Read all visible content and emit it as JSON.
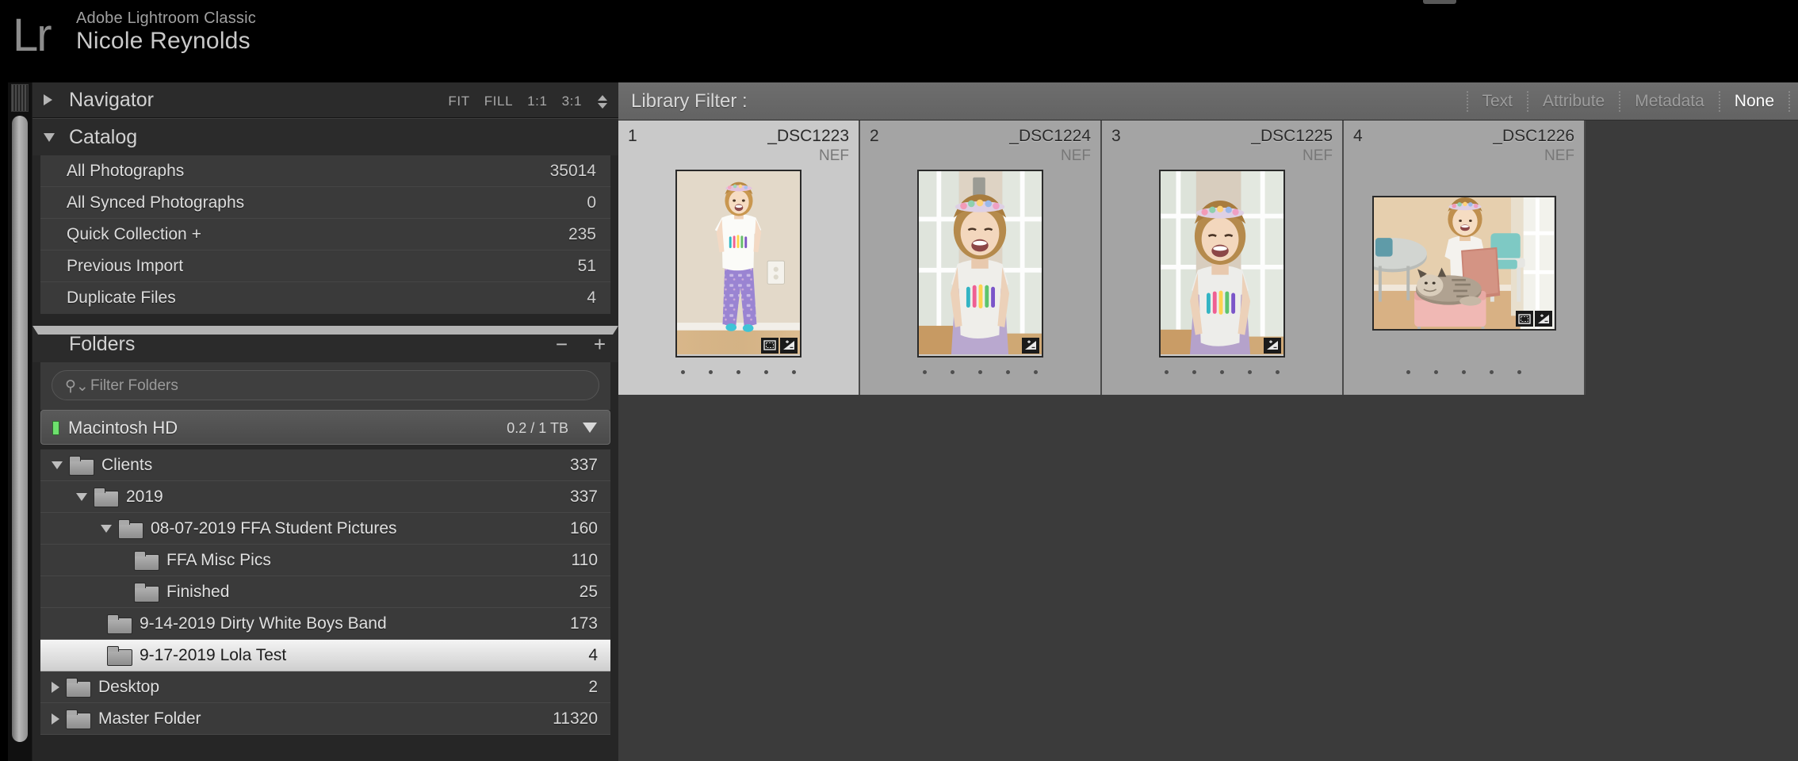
{
  "titlebar": {
    "logo": "Lr",
    "app_name": "Adobe Lightroom Classic",
    "user_name": "Nicole Reynolds"
  },
  "left_panel": {
    "navigator": {
      "title": "Navigator",
      "expanded": false,
      "zoom_levels": [
        "FIT",
        "FILL",
        "1:1",
        "3:1"
      ]
    },
    "catalog": {
      "title": "Catalog",
      "expanded": true,
      "items": [
        {
          "label": "All Photographs",
          "count": "35014"
        },
        {
          "label": "All Synced Photographs",
          "count": "0"
        },
        {
          "label": "Quick Collection",
          "plus": "+",
          "count": "235"
        },
        {
          "label": "Previous Import",
          "count": "51"
        },
        {
          "label": "Duplicate Files",
          "count": "4"
        }
      ]
    },
    "folders": {
      "title": "Folders",
      "expanded": true,
      "minus_label": "−",
      "plus_label": "+",
      "filter_placeholder": "Filter Folders",
      "volume": {
        "name": "Macintosh HD",
        "size": "0.2 / 1 TB",
        "led_color": "#6de06d"
      },
      "tree": [
        {
          "label": "Clients",
          "count": "337",
          "indent": 0,
          "disclosure": "down",
          "selected": false
        },
        {
          "label": "2019",
          "count": "337",
          "indent": 1,
          "disclosure": "down",
          "selected": false
        },
        {
          "label": "08-07-2019 FFA Student Pictures",
          "count": "160",
          "indent": 2,
          "disclosure": "down",
          "selected": false
        },
        {
          "label": "FFA Misc Pics",
          "count": "110",
          "indent": 3,
          "disclosure": "dots",
          "selected": false
        },
        {
          "label": "Finished",
          "count": "25",
          "indent": 3,
          "disclosure": "dots",
          "selected": false
        },
        {
          "label": "9-14-2019 Dirty White Boys Band",
          "count": "173",
          "indent": 2,
          "disclosure": "dots",
          "selected": false
        },
        {
          "label": "9-17-2019 Lola Test",
          "count": "4",
          "indent": 2,
          "disclosure": "dots",
          "selected": true
        },
        {
          "label": "Desktop",
          "count": "2",
          "indent": 0,
          "disclosure": "right",
          "selected": false
        },
        {
          "label": "Master Folder",
          "count": "11320",
          "indent": 0,
          "disclosure": "right",
          "selected": false
        }
      ]
    }
  },
  "library_filter": {
    "label": "Library Filter :",
    "options": [
      {
        "label": "Text",
        "active": false
      },
      {
        "label": "Attribute",
        "active": false
      },
      {
        "label": "Metadata",
        "active": false
      },
      {
        "label": "None",
        "active": true
      }
    ]
  },
  "grid": {
    "cells": [
      {
        "index": "1",
        "filename": "_DSC1223",
        "ext": "NEF",
        "selected": true,
        "orientation": "portrait",
        "badges": [
          "crop-badge",
          "develop-badge"
        ],
        "rating_dots": 5
      },
      {
        "index": "2",
        "filename": "_DSC1224",
        "ext": "NEF",
        "selected": false,
        "orientation": "portrait",
        "badges": [
          "develop-badge"
        ],
        "rating_dots": 5
      },
      {
        "index": "3",
        "filename": "_DSC1225",
        "ext": "NEF",
        "selected": false,
        "orientation": "portrait",
        "badges": [
          "develop-badge"
        ],
        "rating_dots": 5
      },
      {
        "index": "4",
        "filename": "_DSC1226",
        "ext": "NEF",
        "selected": false,
        "orientation": "landscape",
        "badges": [
          "crop-badge",
          "develop-badge"
        ],
        "rating_dots": 5
      }
    ]
  },
  "colors": {
    "panel_bg": "#262626",
    "panel_body": "#3a3a3a",
    "content_bg": "#3b3b3b",
    "filterbar_bg": "#6e6e6e",
    "cell_bg": "#a4a4a4",
    "cell_selected_bg": "#c9c9c9",
    "accent_text": "#ffffff"
  }
}
